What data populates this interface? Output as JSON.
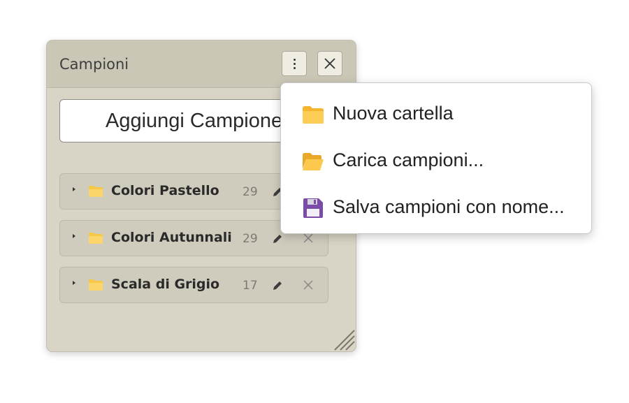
{
  "panel": {
    "title": "Campioni",
    "more_icon": "more-vertical-icon",
    "close_icon": "close-icon",
    "add_button_label": "Aggiungi Campione"
  },
  "folders": [
    {
      "name": "Colori Pastello",
      "count": "29"
    },
    {
      "name": "Colori Autunnali",
      "count": "29"
    },
    {
      "name": "Scala di Grigio",
      "count": "17"
    }
  ],
  "menu": {
    "items": [
      {
        "label": "Nuova cartella",
        "icon": "folder-icon"
      },
      {
        "label": "Carica campioni...",
        "icon": "folder-open-icon"
      },
      {
        "label": "Salva campioni con nome...",
        "icon": "floppy-disk-icon"
      }
    ]
  },
  "colors": {
    "panel_bg": "#d9d5c6",
    "header_bg": "#cbc7b6",
    "folder_yellow": "#f7c843",
    "floppy_purple": "#7a4ca8"
  }
}
